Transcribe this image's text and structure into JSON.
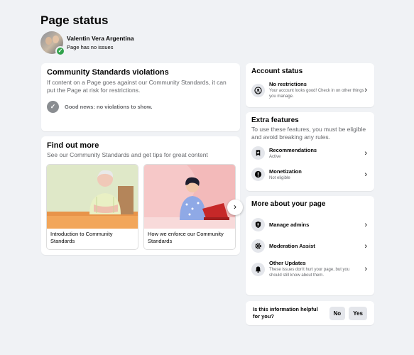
{
  "title": "Page status",
  "page": {
    "name": "Valentin Vera Argentina",
    "status": "Page has no issues"
  },
  "community_standards": {
    "title": "Community Standards violations",
    "description": "If content on a Page goes against our Community Standards, it can put the Page at risk for restrictions.",
    "good_news": "Good news: no violations to show."
  },
  "find_out_more": {
    "title": "Find out more",
    "description": "See our Community Standards and get tips for great content",
    "tips": [
      {
        "caption": "Introduction to Community Standards"
      },
      {
        "caption": "How we enforce our Community Standards"
      }
    ]
  },
  "account_status": {
    "title": "Account status",
    "items": [
      {
        "title": "No restrictions",
        "subtitle": "Your account looks good! Check in on other things you manage.",
        "icon": "account-icon"
      }
    ]
  },
  "extra_features": {
    "title": "Extra features",
    "description": "To use these features, you must be eligible and avoid breaking any rules.",
    "items": [
      {
        "title": "Recommendations",
        "subtitle": "Active",
        "icon": "recommendations-icon"
      },
      {
        "title": "Monetization",
        "subtitle": "Not eligible",
        "icon": "monetization-icon"
      }
    ]
  },
  "more_about": {
    "title": "More about your page",
    "items": [
      {
        "title": "Manage admins",
        "icon": "shield-icon"
      },
      {
        "title": "Moderation Assist",
        "icon": "gear-icon"
      },
      {
        "title": "Other Updates",
        "subtitle": "These issues don't hurt your page, but you should still know about them.",
        "icon": "bell-icon"
      }
    ]
  },
  "feedback": {
    "question": "Is this information helpful for you?",
    "no": "No",
    "yes": "Yes"
  },
  "colors": {
    "background": "#f0f2f5",
    "success": "#31a24c",
    "secondary_text": "#65676b"
  }
}
